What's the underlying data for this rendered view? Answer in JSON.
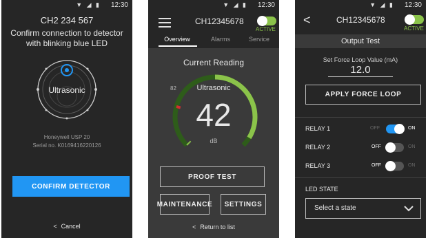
{
  "status": {
    "time": "12:30",
    "icons": "▼ ◢ ▮"
  },
  "screen1": {
    "device_id": "CH2 234 567",
    "instruction": "Confirm connection to detector with blinking blue LED",
    "detector_label": "Ultrasonic",
    "model": "Honeywell USP 20",
    "serial": "Serial no. K0169416220126",
    "confirm_button": "CONFIRM DETECTOR",
    "cancel_link": "Cancel",
    "colors": {
      "accent": "#2196f3"
    }
  },
  "screen2": {
    "device_id": "CH12345678",
    "active_badge": "ACTIVE",
    "tabs": [
      {
        "label": "Overview",
        "active": true
      },
      {
        "label": "Alarms",
        "active": false
      },
      {
        "label": "Service",
        "active": false
      }
    ],
    "section_title": "Current Reading",
    "gauge": {
      "label": "Ultrasonic",
      "value": "42",
      "unit": "dB",
      "marker": "82",
      "fill_fraction": 0.45
    },
    "proof_test_button": "PROOF TEST",
    "maintenance_button": "MAINTENANCE",
    "settings_button": "SETTINGS",
    "return_link": "Return to list",
    "colors": {
      "gauge_fill": "#8bc34a",
      "gauge_track": "#2e5c1a",
      "marker": "#d32f2f"
    }
  },
  "screen3": {
    "device_id": "CH12345678",
    "active_badge": "ACTIVE",
    "title": "Output Test",
    "force_label": "Set Force Loop Value (mA)",
    "force_value": "12.0",
    "apply_button": "APPLY FORCE LOOP",
    "relays": [
      {
        "label": "RELAY 1",
        "off": "OFF",
        "on": "ON",
        "state": "on"
      },
      {
        "label": "RELAY 2",
        "off": "OFF",
        "on": "ON",
        "state": "off"
      },
      {
        "label": "RELAY 3",
        "off": "OFF",
        "on": "ON",
        "state": "off"
      }
    ],
    "led_label": "LED STATE",
    "led_select_value": "Select a state",
    "colors": {
      "toggle_on": "#2196f3",
      "active_green": "#8bc34a"
    }
  }
}
